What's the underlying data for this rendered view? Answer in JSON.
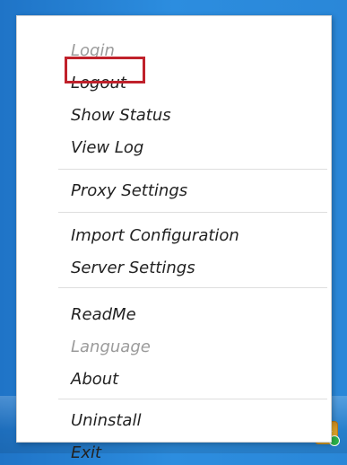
{
  "menu": {
    "items": [
      {
        "label": "Login",
        "disabled": true
      },
      {
        "label": "Logout",
        "disabled": false
      },
      {
        "label": "Show Status",
        "disabled": false
      },
      {
        "label": "View Log",
        "disabled": false
      },
      {
        "label": "Proxy Settings",
        "disabled": false
      },
      {
        "label": "Import Configuration",
        "disabled": false
      },
      {
        "label": "Server Settings",
        "disabled": false
      },
      {
        "label": "ReadMe",
        "disabled": false
      },
      {
        "label": "Language",
        "disabled": true
      },
      {
        "label": "About",
        "disabled": false
      },
      {
        "label": "Uninstall",
        "disabled": false
      },
      {
        "label": "Exit",
        "disabled": false
      }
    ]
  },
  "taskbar": {
    "tray_icon_name": "tray-app-icon"
  },
  "colors": {
    "highlight_box": "#c0212b"
  }
}
